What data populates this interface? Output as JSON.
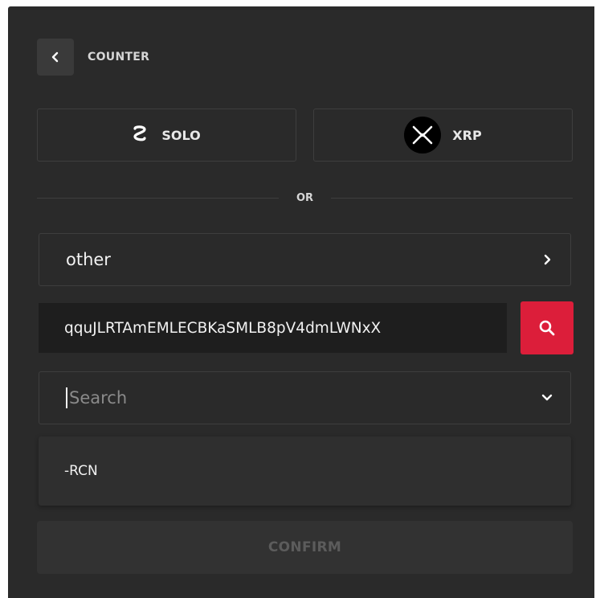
{
  "header": {
    "title": "COUNTER",
    "back_icon": "chevron-left-icon"
  },
  "assets": {
    "solo": {
      "label": "SOLO",
      "icon": "solo-logo-icon",
      "glyph": "S"
    },
    "xrp": {
      "label": "XRP",
      "icon": "xrp-logo-icon"
    }
  },
  "divider": {
    "label": "OR"
  },
  "currency_select": {
    "value": "other",
    "icon": "chevron-right-icon"
  },
  "issuer": {
    "value": "qquJLRTAmEMLECBKaSMLB8pV4dmLWNxX",
    "search_icon": "search-icon"
  },
  "search": {
    "placeholder": "Search",
    "icon": "chevron-down-icon"
  },
  "dropdown": {
    "items": [
      {
        "label": "-RCN"
      }
    ]
  },
  "confirm": {
    "label": "CONFIRM"
  },
  "colors": {
    "panel_bg": "#2a2a2a",
    "accent_red": "#dc1e3a",
    "border": "#3e3e3e"
  }
}
